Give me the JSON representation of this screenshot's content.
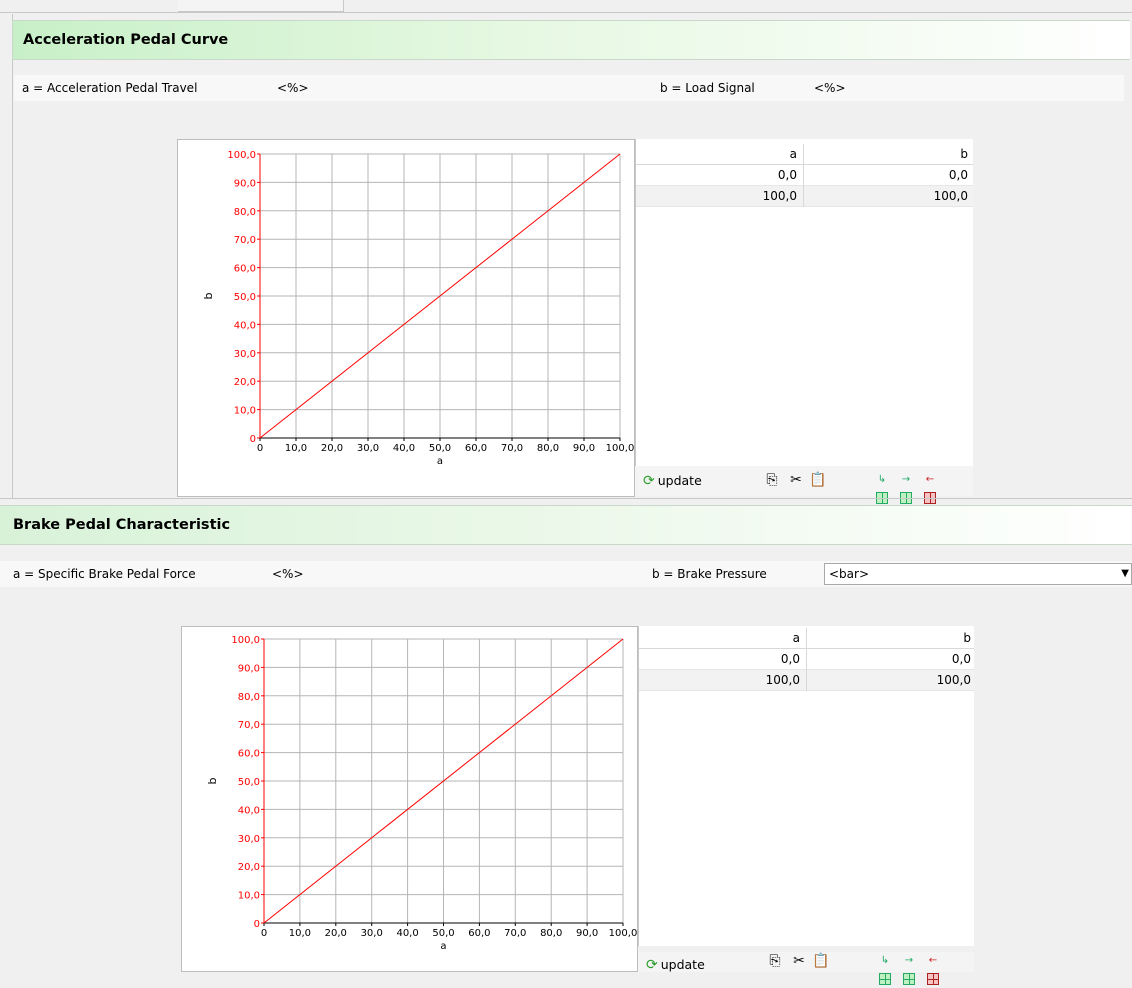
{
  "sections": [
    {
      "title": "Acceleration Pedal Curve",
      "a_label": "a = Acceleration Pedal Travel",
      "a_unit": "<%>",
      "b_label": "b = Load Signal",
      "b_unit": "<%>",
      "table": {
        "headers": [
          "a",
          "b"
        ],
        "rows": [
          [
            "0,0",
            "0,0"
          ],
          [
            "100,0",
            "100,0"
          ]
        ]
      },
      "toolbar": {
        "update_label": "update",
        "update_icon": "refresh-icon",
        "copy_icon": "copy-icon",
        "cut_icon": "cut-icon",
        "paste_icon": "paste-icon",
        "insert_row_below_icon": "insert-row-below-icon",
        "insert_row_icon": "insert-row-icon",
        "delete_row_icon": "delete-row-icon"
      }
    },
    {
      "title": "Brake Pedal Characteristic",
      "a_label": "a = Specific Brake Pedal Force",
      "a_unit": "<%>",
      "b_label": "b = Brake Pressure",
      "b_unit": "<bar>",
      "table": {
        "headers": [
          "a",
          "b"
        ],
        "rows": [
          [
            "0,0",
            "0,0"
          ],
          [
            "100,0",
            "100,0"
          ]
        ]
      },
      "toolbar": {
        "update_label": "update",
        "update_icon": "refresh-icon",
        "copy_icon": "copy-icon",
        "cut_icon": "cut-icon",
        "paste_icon": "paste-icon",
        "insert_row_below_icon": "insert-row-below-icon",
        "insert_row_icon": "insert-row-icon",
        "delete_row_icon": "delete-row-icon"
      }
    }
  ],
  "chart_data": [
    {
      "type": "line",
      "xlabel": "a",
      "ylabel": "b",
      "xlim": [
        0,
        100
      ],
      "ylim": [
        0,
        100
      ],
      "xticks": [
        "0",
        "10,0",
        "20,0",
        "30,0",
        "40,0",
        "50,0",
        "60,0",
        "70,0",
        "80,0",
        "90,0",
        "100,0"
      ],
      "yticks": [
        "0",
        "10,0",
        "20,0",
        "30,0",
        "40,0",
        "50,0",
        "60,0",
        "70,0",
        "80,0",
        "90,0",
        "100,0"
      ],
      "grid": true,
      "series": [
        {
          "x": [
            0,
            100
          ],
          "y": [
            0,
            100
          ],
          "color": "#ff0000"
        }
      ],
      "tick_color_y": "#ff0000"
    },
    {
      "type": "line",
      "xlabel": "a",
      "ylabel": "b",
      "xlim": [
        0,
        100
      ],
      "ylim": [
        0,
        100
      ],
      "xticks": [
        "0",
        "10,0",
        "20,0",
        "30,0",
        "40,0",
        "50,0",
        "60,0",
        "70,0",
        "80,0",
        "90,0",
        "100,0"
      ],
      "yticks": [
        "0",
        "10,0",
        "20,0",
        "30,0",
        "40,0",
        "50,0",
        "60,0",
        "70,0",
        "80,0",
        "90,0",
        "100,0"
      ],
      "grid": true,
      "series": [
        {
          "x": [
            0,
            100
          ],
          "y": [
            0,
            100
          ],
          "color": "#ff0000"
        }
      ],
      "tick_color_y": "#ff0000"
    }
  ]
}
